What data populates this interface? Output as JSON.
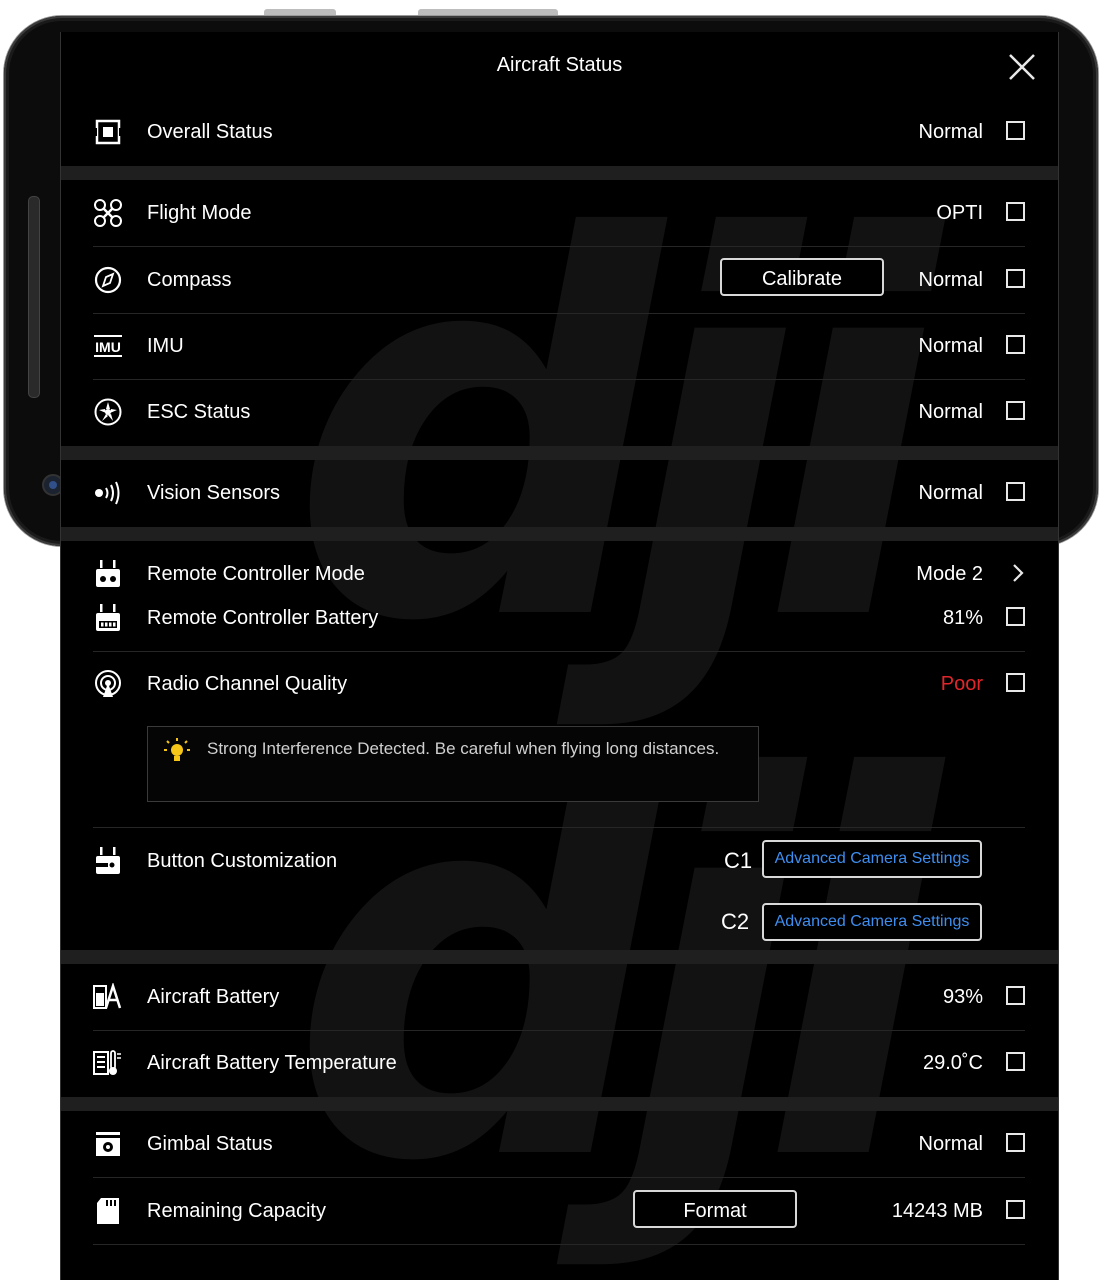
{
  "header": {
    "title": "Aircraft Status"
  },
  "rows": {
    "overall": {
      "label": "Overall Status",
      "value": "Normal"
    },
    "flight_mode": {
      "label": "Flight Mode",
      "value": "OPTI"
    },
    "compass": {
      "label": "Compass",
      "value": "Normal",
      "button": "Calibrate"
    },
    "imu": {
      "label": "IMU",
      "value": "Normal"
    },
    "esc": {
      "label": "ESC Status",
      "value": "Normal"
    },
    "vision": {
      "label": "Vision Sensors",
      "value": "Normal"
    },
    "rc_mode": {
      "label": "Remote Controller Mode",
      "value": "Mode 2"
    },
    "rc_battery": {
      "label": "Remote Controller Battery",
      "value": "81%"
    },
    "radio": {
      "label": "Radio Channel Quality",
      "value": "Poor"
    },
    "button_custom": {
      "label": "Button Customization",
      "c1": "C1",
      "c1_value": "Advanced Camera Settings",
      "c2": "C2",
      "c2_value": "Advanced Camera Settings"
    },
    "aircraft_battery": {
      "label": "Aircraft Battery",
      "value": "93%"
    },
    "battery_temp": {
      "label": "Aircraft Battery Temperature",
      "value": "29.0˚C"
    },
    "gimbal": {
      "label": "Gimbal Status",
      "value": "Normal"
    },
    "capacity": {
      "label": "Remaining Capacity",
      "value": "14243 MB",
      "button": "Format"
    }
  },
  "tip": {
    "text": "Strong Interference Detected. Be careful when flying long distances."
  },
  "watermark": "dji",
  "colors": {
    "background": "#000000",
    "text": "#ffffff",
    "warning": "#e0262a",
    "link": "#3e8ef0",
    "separator": "#1f1f1f"
  }
}
